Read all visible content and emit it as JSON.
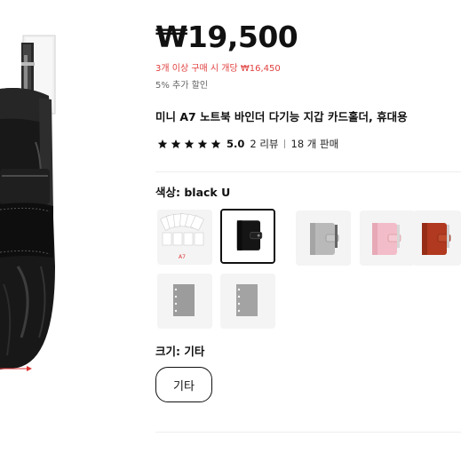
{
  "product": {
    "price": "₩19,500",
    "bulk_discount": "3개 이상 구매 시 개당 ₩16,450",
    "extra_discount": "5% 추가 할인",
    "title": "미니 A7 노트북 바인더 다기능 지갑 카드홀더, 휴대용",
    "rating": {
      "stars": 5,
      "value": "5.0",
      "reviews": "2 리뷰",
      "sales": "18 개 판매"
    }
  },
  "color": {
    "label": "색상: black U",
    "swatches": [
      {
        "name": "A7 insert pages",
        "icon": "pages-icon",
        "selected": false,
        "caption": "A7"
      },
      {
        "name": "black U",
        "icon": "wallet-icon",
        "color": "#151515",
        "selected": true
      },
      {
        "name": "silver",
        "icon": "wallet-icon",
        "color": "#b9b9b9",
        "selected": false
      },
      {
        "name": "pink",
        "icon": "wallet-icon",
        "color": "#f2bcc8",
        "selected": false
      },
      {
        "name": "brown",
        "icon": "wallet-icon",
        "color": "#b0391f",
        "selected": false
      },
      {
        "name": "gray insert A",
        "icon": "insert-icon",
        "color": "#9c9c9c",
        "selected": false
      },
      {
        "name": "gray insert B",
        "icon": "insert-icon",
        "color": "#a3a3a3",
        "selected": false
      }
    ]
  },
  "size": {
    "label": "크기: 기타",
    "options": [
      "기타"
    ],
    "selected": "기타"
  },
  "colors": {
    "bulk_text": "#e0413f",
    "selected_border": "#111111"
  }
}
